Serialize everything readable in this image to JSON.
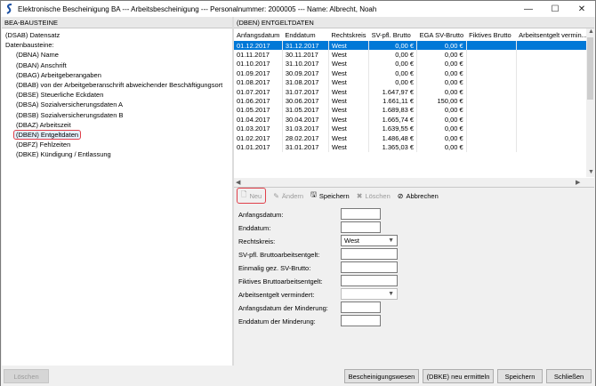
{
  "window": {
    "title": "Elektronische Bescheinigung BA  --- Arbeitsbescheinigung  --- Personalnummer: 2000005  --- Name: Albrecht, Noah",
    "minimize": "—",
    "maximize": "☐",
    "close": "✕"
  },
  "left_panel": {
    "header": "BEA-BAUSTEINE",
    "items": [
      {
        "label": "(DSAB) Datensatz"
      },
      {
        "label": "Datenbausteine:"
      },
      {
        "label": "(DBNA) Name"
      },
      {
        "label": "(DBAN) Anschrift"
      },
      {
        "label": "(DBAG) Arbeitgeberangaben"
      },
      {
        "label": "(DBAB) von der Arbeitgeberanschrift abweichender Beschäftigungsort"
      },
      {
        "label": "(DBSE) Steuerliche Eckdaten"
      },
      {
        "label": "(DBSA) Sozialversicherungsdaten A"
      },
      {
        "label": "(DBSB) Sozialversicherungsdaten B"
      },
      {
        "label": "(DBAZ) Arbeitszeit"
      },
      {
        "label": "(DBEN) Entgeltdaten"
      },
      {
        "label": "(DBFZ) Fehlzeiten"
      },
      {
        "label": "(DBKE) Kündigung / Entlassung"
      }
    ]
  },
  "right_panel": {
    "header": "(DBEN) ENTGELTDATEN",
    "columns": [
      "Anfangsdatum",
      "Enddatum",
      "Rechtskreis",
      "SV-pfl. Brutto",
      "EGA SV-Brutto",
      "Fiktives Brutto",
      "Arbeitsentgelt vermin..."
    ],
    "rows": [
      [
        "01.12.2017",
        "31.12.2017",
        "West",
        "0,00 €",
        "0,00 €",
        "",
        ""
      ],
      [
        "01.11.2017",
        "30.11.2017",
        "West",
        "0,00 €",
        "0,00 €",
        "",
        ""
      ],
      [
        "01.10.2017",
        "31.10.2017",
        "West",
        "0,00 €",
        "0,00 €",
        "",
        ""
      ],
      [
        "01.09.2017",
        "30.09.2017",
        "West",
        "0,00 €",
        "0,00 €",
        "",
        ""
      ],
      [
        "01.08.2017",
        "31.08.2017",
        "West",
        "0,00 €",
        "0,00 €",
        "",
        ""
      ],
      [
        "01.07.2017",
        "31.07.2017",
        "West",
        "1.647,97 €",
        "0,00 €",
        "",
        ""
      ],
      [
        "01.06.2017",
        "30.06.2017",
        "West",
        "1.661,11 €",
        "150,00 €",
        "",
        ""
      ],
      [
        "01.05.2017",
        "31.05.2017",
        "West",
        "1.689,83 €",
        "0,00 €",
        "",
        ""
      ],
      [
        "01.04.2017",
        "30.04.2017",
        "West",
        "1.665,74 €",
        "0,00 €",
        "",
        ""
      ],
      [
        "01.03.2017",
        "31.03.2017",
        "West",
        "1.639,55 €",
        "0,00 €",
        "",
        ""
      ],
      [
        "01.02.2017",
        "28.02.2017",
        "West",
        "1.486,48 €",
        "0,00 €",
        "",
        ""
      ],
      [
        "01.01.2017",
        "31.01.2017",
        "West",
        "1.365,03 €",
        "0,00 €",
        "",
        ""
      ]
    ],
    "toolbar": {
      "neu": "Neu",
      "aendern": "Ändern",
      "speichern": "Speichern",
      "loeschen": "Löschen",
      "abbrechen": "Abbrechen"
    },
    "form": {
      "anfangsdatum": "Anfangsdatum:",
      "enddatum": "Enddatum:",
      "rechtskreis": "Rechtskreis:",
      "rechtskreis_value": "West",
      "sv_brutto": "SV-pfl. Bruttoarbeitsentgelt:",
      "einmalig": "Einmalig gez. SV-Brutto:",
      "fiktiv": "Fiktives Bruttoarbeitsentgelt:",
      "vermindert": "Arbeitsentgelt vermindert:",
      "anfang_minderung": "Anfangsdatum der Minderung:",
      "ende_minderung": "Enddatum der Minderung:"
    }
  },
  "footer": {
    "loeschen": "Löschen",
    "bescheinigungswesen": "Bescheinigungswesen",
    "dben_neu": "(DBKE) neu ermitteln",
    "speichern": "Speichern",
    "schliessen": "Schließen"
  },
  "colors": {
    "selection": "#0078d7",
    "highlight_outline": "#e0404a"
  }
}
